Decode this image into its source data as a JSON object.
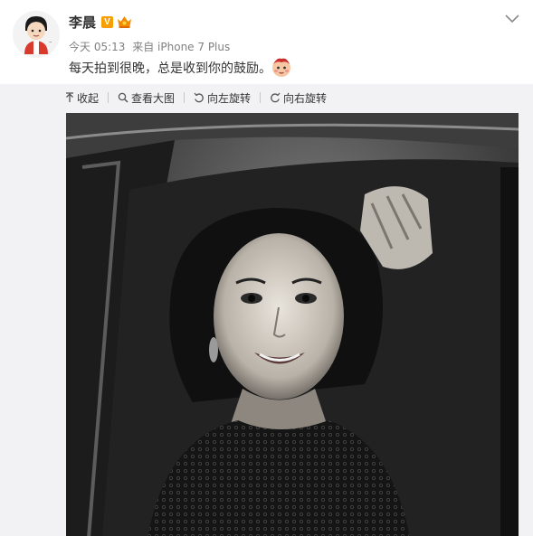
{
  "post": {
    "username": "李晨",
    "verified_badge": "V",
    "time": "今天 05:13",
    "source": "来自 iPhone 7 Plus",
    "text": "每天拍到很晚，总是收到你的鼓励。",
    "icons": {
      "avatar": "avatar-cartoon",
      "member": "member-crown-icon",
      "emoji": "emoji-icon",
      "menu": "chevron-down-icon"
    }
  },
  "toolbar": {
    "collapse": "收起",
    "view_large": "查看大图",
    "rotate_left": "向左旋转",
    "rotate_right": "向右旋转"
  },
  "colors": {
    "badge": "#f5a000",
    "member": "#f38a00",
    "toolbar_bg": "#f2f2f5",
    "text": "#333333",
    "meta": "#808080"
  }
}
